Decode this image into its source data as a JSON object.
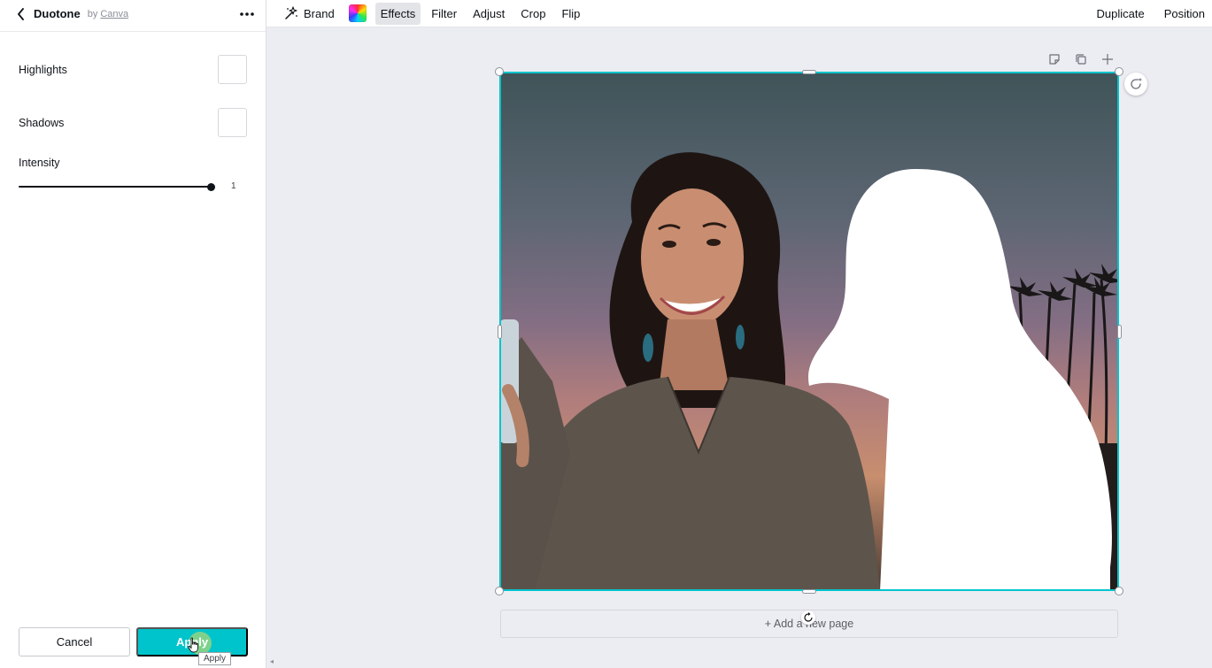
{
  "panel": {
    "title": "Duotone",
    "by_prefix": "by",
    "by_link": "Canva",
    "highlights_label": "Highlights",
    "shadows_label": "Shadows",
    "intensity_label": "Intensity",
    "intensity_value": "1",
    "intensity_fraction": 1.0,
    "cancel_label": "Cancel",
    "apply_label": "Apply",
    "apply_tooltip": "Apply"
  },
  "toolbar": {
    "brand_label": "Brand",
    "effects_label": "Effects",
    "filter_label": "Filter",
    "adjust_label": "Adjust",
    "crop_label": "Crop",
    "flip_label": "Flip",
    "duplicate_label": "Duplicate",
    "position_label": "Position",
    "active_item": "Effects"
  },
  "canvas": {
    "add_page_label": "+ Add a new page",
    "selection_color": "#00c4cc"
  },
  "icons": {
    "back": "chevron-left-icon",
    "more": "more-horizontal-icon",
    "brand": "magic-sparkle-icon",
    "note": "note-icon",
    "copy": "copy-icon",
    "add": "plus-icon",
    "rotate": "rotate-icon"
  },
  "colors": {
    "accent": "#00c4cc",
    "panel_bg": "#ffffff",
    "canvas_bg": "#ecedf2"
  }
}
